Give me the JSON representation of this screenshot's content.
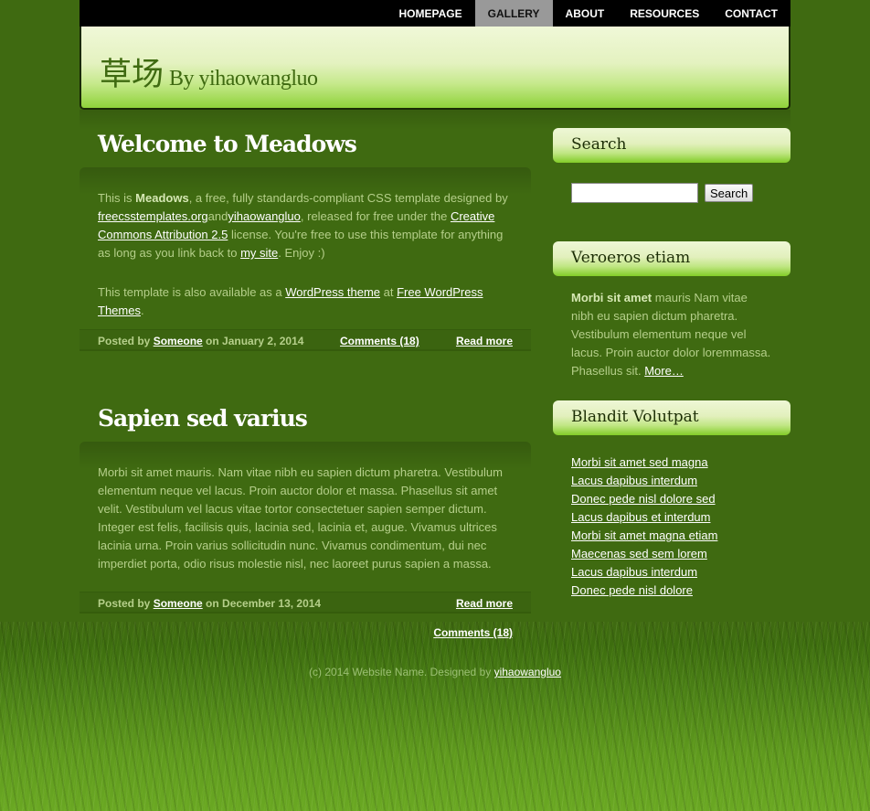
{
  "nav": {
    "items": [
      "HOMEPAGE",
      "GALLERY",
      "ABOUT",
      "RESOURCES",
      "CONTACT"
    ],
    "active": "GALLERY"
  },
  "header": {
    "title": "草场",
    "subtitle": "By yihaowangluo"
  },
  "posts": [
    {
      "title": "Welcome to Meadows",
      "p1": {
        "t1": "This is ",
        "bold": "Meadows",
        "t2": ", a free, fully standards-compliant CSS template designed by ",
        "link1": "freecsstemplates.org",
        "t3": "and",
        "link2": "yihaowangluo",
        "t4": ", released for free under the ",
        "link3": "Creative Commons Attribution 2.5",
        "t5": " license. You're free to use this template for anything as long as you link back to ",
        "link4": "my site",
        "t6": ". Enjoy :)"
      },
      "p2": {
        "t1": "This template is also available as a ",
        "link1": "WordPress theme",
        "t2": " at ",
        "link2": "Free WordPress Themes",
        "t3": "."
      },
      "meta": {
        "posted_by": "Posted by ",
        "author": "Someone",
        "date": " on January 2, 2014",
        "comments": "Comments (18)",
        "read_more": "Read more"
      }
    },
    {
      "title": "Sapien sed varius",
      "body": "Morbi sit amet mauris. Nam vitae nibh eu sapien dictum pharetra. Vestibulum elementum neque vel lacus. Proin auctor dolor et massa. Phasellus sit amet velit. Vestibulum vel lacus vitae tortor consectetuer sapien semper dictum. Integer est felis, facilisis quis, lacinia sed, lacinia et, augue. Vivamus ultrices lacinia urna. Proin varius sollicitudin nunc. Vivamus condimentum, dui nec imperdiet porta, odio risus molestie nisl, nec laoreet purus sapien a massa.",
      "meta": {
        "posted_by": "Posted by ",
        "author": "Someone",
        "date": " on December 13, 2014",
        "read_more": "Read more",
        "comments": "Comments (18)"
      }
    }
  ],
  "sidebar": {
    "search": {
      "title": "Search",
      "button": "Search",
      "value": ""
    },
    "veroeros": {
      "title": "Veroeros etiam",
      "bold": "Morbi sit amet",
      "text": " mauris Nam vitae nibh eu sapien dictum pharetra. Vestibulum elementum neque vel lacus. Proin auctor dolor loremmassa. Phasellus sit. ",
      "more": "More…"
    },
    "blandit": {
      "title": "Blandit Volutpat",
      "links": [
        "Morbi sit amet sed magna",
        "Lacus dapibus interdum",
        "Donec pede nisl dolore sed",
        "Lacus dapibus et interdum",
        "Morbi sit amet magna etiam",
        "Maecenas sed sem lorem",
        "Lacus dapibus interdum",
        "Donec pede nisl dolore"
      ]
    }
  },
  "footer": {
    "text": "(c) 2014 Website Name. Designed by ",
    "link": "yihaowangluo"
  },
  "colors": {
    "background": "#3f6a11",
    "header_gradient_bottom": "#8fd23a",
    "text": "#b5cf8a",
    "link": "#ffffff",
    "active_nav": "#999999"
  }
}
